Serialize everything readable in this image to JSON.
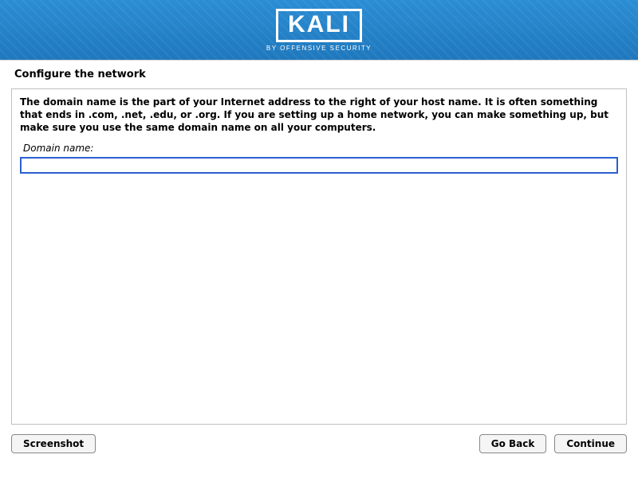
{
  "branding": {
    "logo_text": "KALI",
    "logo_subtitle": "BY OFFENSIVE SECURITY"
  },
  "page": {
    "title": "Configure the network",
    "description": "The domain name is the part of your Internet address to the right of your host name.  It is often something that ends in .com, .net, .edu, or .org.  If you are setting up a home network, you can make something up, but make sure you use the same domain name on all your computers.",
    "field_label": "Domain name:",
    "domain_value": ""
  },
  "buttons": {
    "screenshot": "Screenshot",
    "go_back": "Go Back",
    "continue": "Continue"
  }
}
